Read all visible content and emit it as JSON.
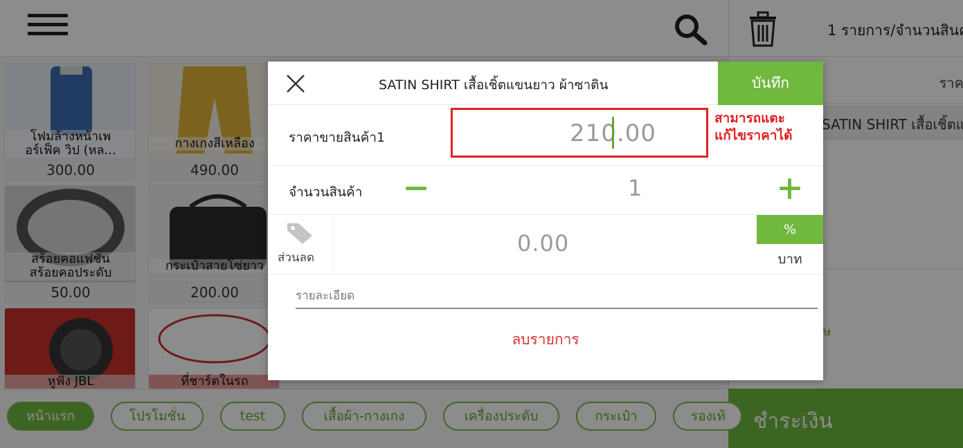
{
  "header": {
    "cart_summary": "1 รายการ/จำนวนสินค"
  },
  "icons": {
    "menu": "menu-icon",
    "search": "search-icon",
    "trash": "trash-icon",
    "close": "close-icon",
    "tag": "tag-icon"
  },
  "products": [
    {
      "name": "โฟมล้างหน้าเพ\nอร์เฟ็ค วิป (หล...",
      "price": "300.00",
      "color": "#3b6db5"
    },
    {
      "name": "กางเกงสีเหลือง",
      "price": "490.00",
      "color": "#e0b43a"
    },
    {
      "name": "สร้อยคอแฟชั่น\nสร้อยคอประดับ",
      "price": "50.00",
      "color": "#7a7a7a"
    },
    {
      "name": "กระเป๋าสายโซ่ยาว",
      "price": "200.00",
      "color": "#2a2a2a"
    },
    {
      "name": "หูฟัง JBL",
      "price": "",
      "color": "#c8312f"
    },
    {
      "name": "ที่ชาร์ตในรถ",
      "price": "",
      "color": "#d9d9d9"
    }
  ],
  "dialog": {
    "close_label": "×",
    "title": "SATIN SHIRT เสื้อเชิ้ตแขนยาว ผ้าซาติน",
    "save_label": "บันทึก",
    "price_label": "ราคาขายสินค้า1",
    "price_value": "210.00",
    "annotation": "สามารถแตะ\nแก้ไขราคาได้",
    "qty_label": "จำนวนสินค้า",
    "qty_value": "1",
    "discount_label": "ส่วนลด",
    "discount_value": "0.00",
    "percent_label": "%",
    "baht_label": "บาท",
    "detail_placeholder": "รายละเอียด",
    "delete_label": "ลบรายการ"
  },
  "right_panel": {
    "head_label": "ราค",
    "item_name": "SATIN SHIRT เสื้อเชิ้ตแ",
    "green_text": "ษ",
    "pay_label": "ชำระเงิน"
  },
  "categories": [
    {
      "label": "หน้าแรก",
      "active": true
    },
    {
      "label": "โปรโมชั่น",
      "active": false
    },
    {
      "label": "test",
      "active": false
    },
    {
      "label": "เสื้อผ้า-กางเกง",
      "active": false
    },
    {
      "label": "เครื่องประดับ",
      "active": false
    },
    {
      "label": "กระเป๋า",
      "active": false
    },
    {
      "label": "รองเท้",
      "active": false
    }
  ],
  "colors": {
    "accent": "#70b83e",
    "annotation": "#e02020",
    "delete": "#d23232"
  }
}
